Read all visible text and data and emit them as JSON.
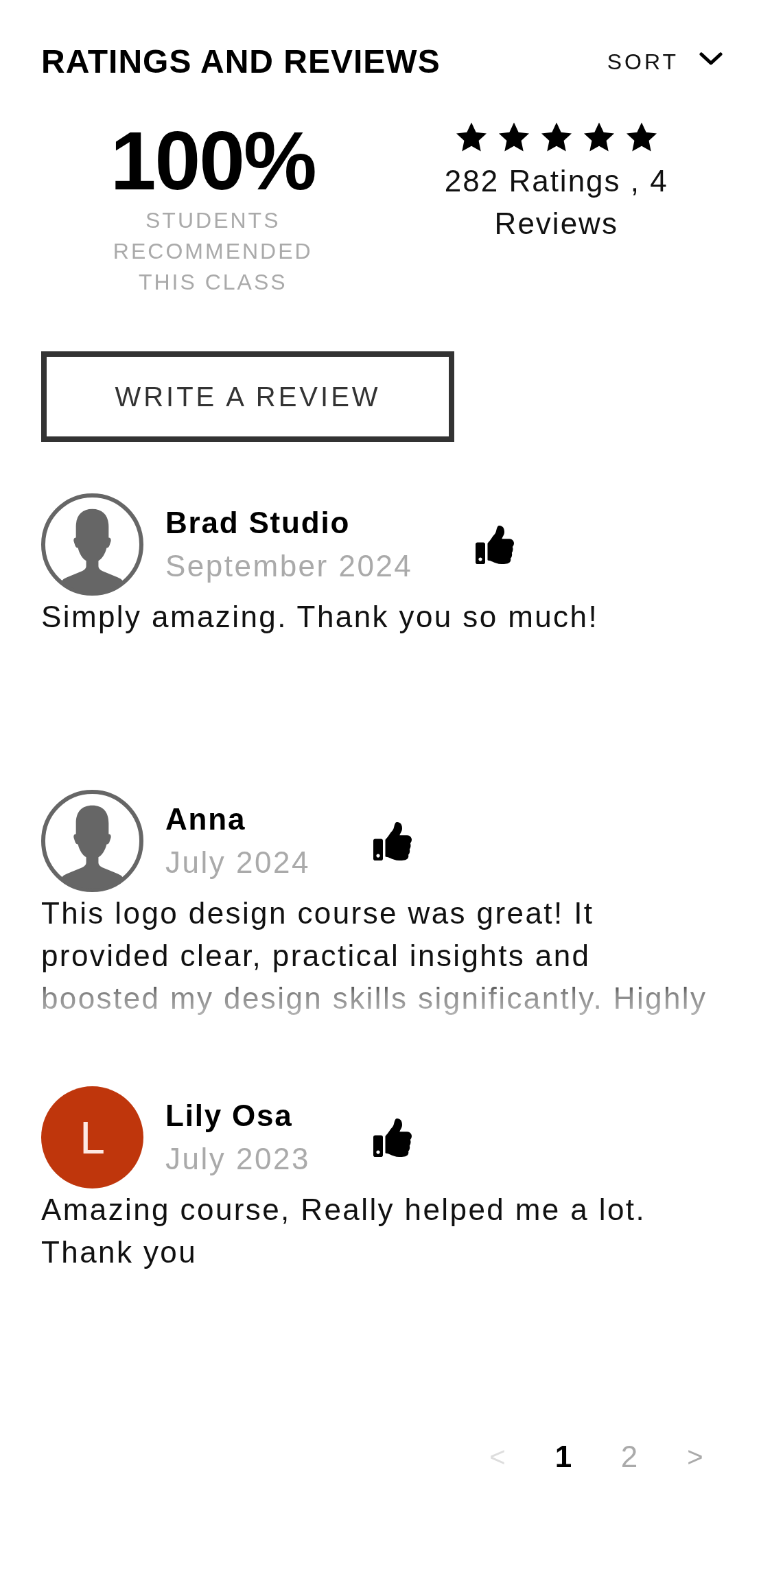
{
  "header": {
    "title": "RATINGS AND REVIEWS",
    "sort": {
      "label": "SORT"
    }
  },
  "summary": {
    "percent": "100%",
    "caption": "STUDENTS RECOMMENDED THIS CLASS",
    "stars": 5,
    "counts": "282 Ratings , 4 Reviews"
  },
  "write_review": {
    "label": "WRITE A REVIEW"
  },
  "reviews": [
    {
      "avatar": {
        "kind": "silhouette"
      },
      "name": "Brad Studio",
      "date": "September 2024",
      "recommended": true,
      "text": "Simply amazing. Thank you so much!",
      "expanded": true
    },
    {
      "avatar": {
        "kind": "silhouette"
      },
      "name": "Anna",
      "date": "July 2024",
      "recommended": true,
      "text": "This logo design course was great! It provided clear, practical insights and boosted my design skills significantly. Highly",
      "expanded": false
    },
    {
      "avatar": {
        "kind": "initial",
        "initial": "L",
        "color": "#bf360c"
      },
      "name": "Lily Osa",
      "date": "July 2023",
      "recommended": true,
      "text": "Amazing course, Really helped me a lot. Thank you",
      "expanded": true
    }
  ],
  "pagination": {
    "prev": {
      "label": "<",
      "disabled": true
    },
    "pages": [
      {
        "label": "1",
        "selected": true
      },
      {
        "label": "2",
        "selected": false
      }
    ],
    "next": {
      "label": ">",
      "disabled": false
    }
  }
}
